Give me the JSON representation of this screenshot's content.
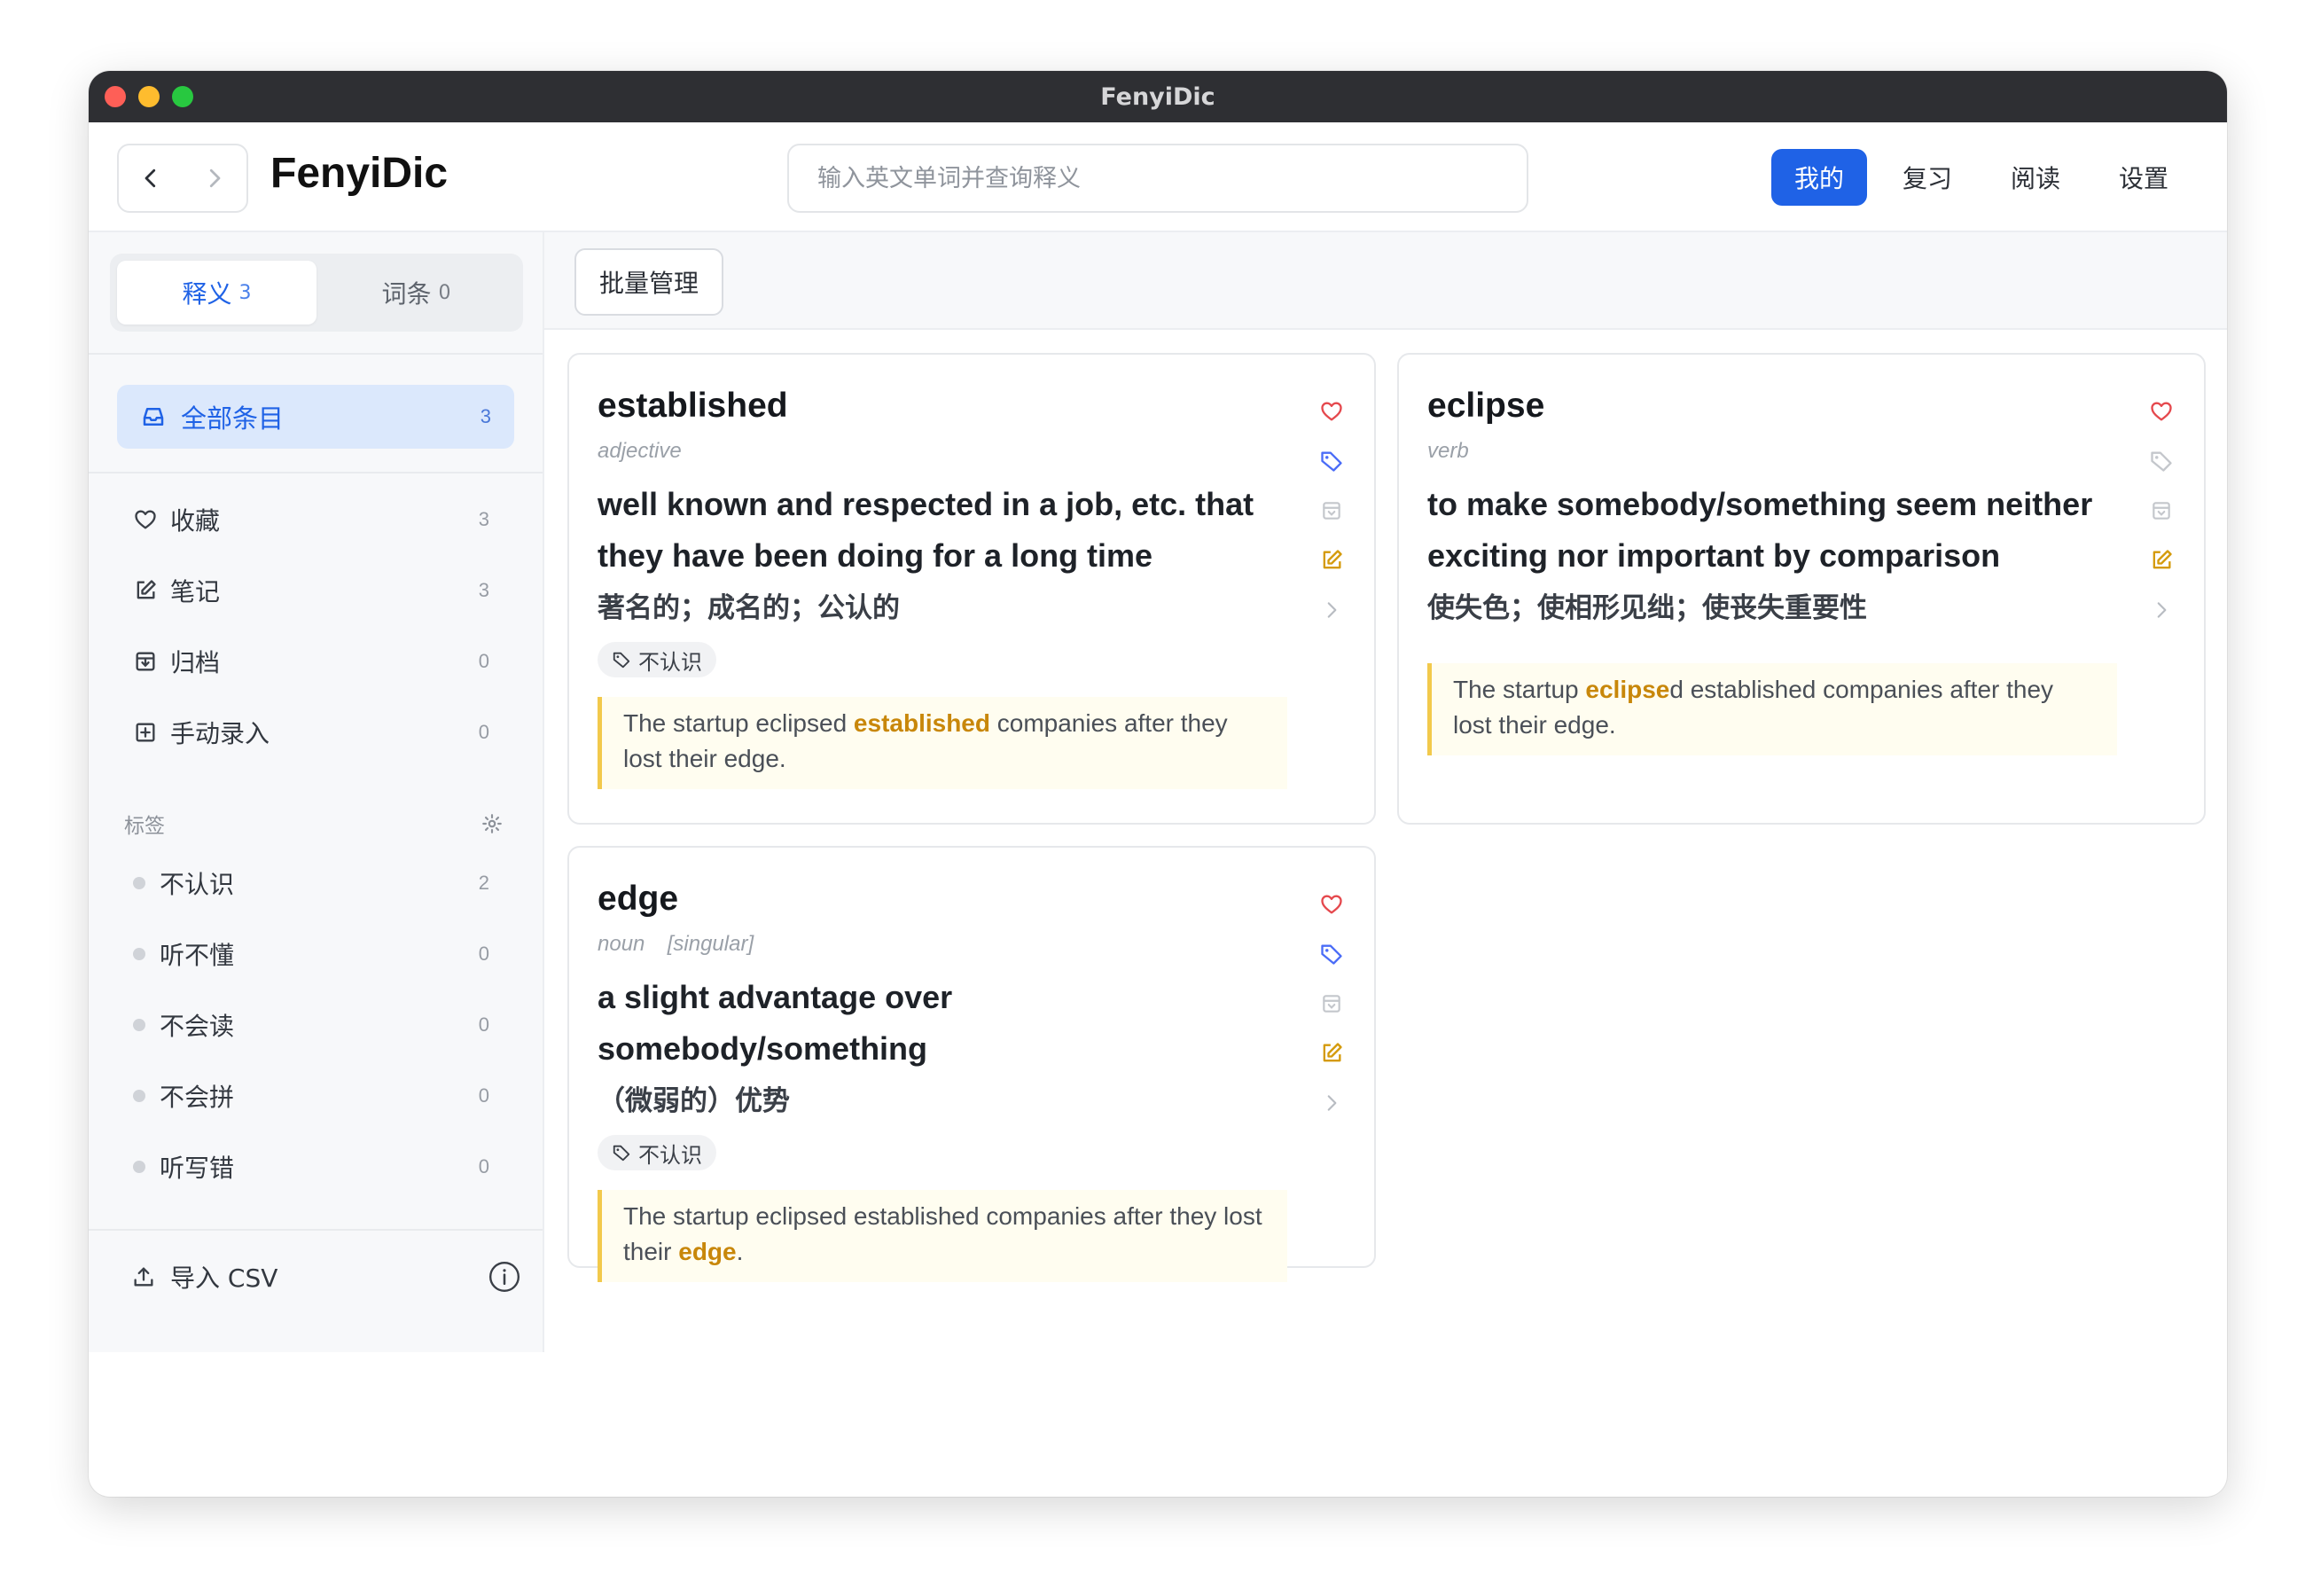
{
  "window": {
    "title": "FenyiDic"
  },
  "header": {
    "brand": "FenyiDic",
    "search_placeholder": "输入英文单词并查询释义",
    "nav": [
      {
        "label": "我的",
        "active": true
      },
      {
        "label": "复习"
      },
      {
        "label": "阅读"
      },
      {
        "label": "设置"
      }
    ]
  },
  "sidebar": {
    "segments": [
      {
        "label": "释义",
        "count": "3",
        "active": true
      },
      {
        "label": "词条",
        "count": "0"
      }
    ],
    "all_items": {
      "label": "全部条目",
      "count": "3"
    },
    "menu": [
      {
        "label": "收藏",
        "count": "3",
        "icon": "heart-icon"
      },
      {
        "label": "笔记",
        "count": "3",
        "icon": "edit-icon"
      },
      {
        "label": "归档",
        "count": "0",
        "icon": "archive-icon"
      },
      {
        "label": "手动录入",
        "count": "0",
        "icon": "plus-square-icon"
      }
    ],
    "tags_title": "标签",
    "tags": [
      {
        "label": "不认识",
        "count": "2"
      },
      {
        "label": "听不懂",
        "count": "0"
      },
      {
        "label": "不会读",
        "count": "0"
      },
      {
        "label": "不会拼",
        "count": "0"
      },
      {
        "label": "听写错",
        "count": "0"
      }
    ],
    "import_label": "导入 CSV"
  },
  "main": {
    "batch_label": "批量管理",
    "cards": [
      {
        "word": "established",
        "pos": "adjective",
        "definition": "well known and respected in a job, etc. that they have been doing for a long time",
        "translation": "著名的；成名的；公认的",
        "tag": "不认识",
        "example_parts": [
          "The startup eclipsed ",
          "established",
          " companies after they lost their edge."
        ]
      },
      {
        "word": "eclipse",
        "pos": "verb",
        "definition": "to make somebody/something seem neither exciting nor important by comparison",
        "translation": "使失色；使相形见绌；使丧失重要性",
        "tag": "",
        "example_parts": [
          "The startup ",
          "eclipse",
          "d established companies after they lost their edge."
        ]
      },
      {
        "word": "edge",
        "pos": "noun  [singular]",
        "definition": "a slight advantage over somebody/something",
        "translation": "（微弱的）优势",
        "tag": "不认识",
        "example_parts": [
          "The startup eclipsed established companies after they lost their ",
          "edge",
          "."
        ]
      }
    ]
  },
  "colors": {
    "accent": "#1f62e6",
    "favorite": "#e5484d",
    "tag": "#4a6cf7",
    "note": "#d49a0a",
    "highlight": "#c8870a"
  }
}
